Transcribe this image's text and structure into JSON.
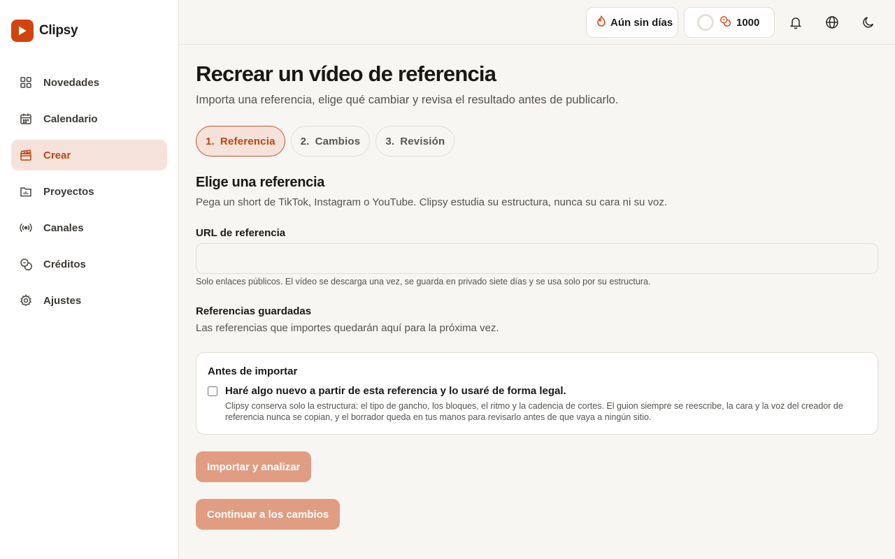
{
  "app": {
    "name": "Clipsy"
  },
  "sidebar": {
    "items": [
      {
        "label": "Novedades",
        "icon": "grid-icon"
      },
      {
        "label": "Calendario",
        "icon": "calendar-icon"
      },
      {
        "label": "Crear",
        "icon": "clapperboard-icon",
        "active": true
      },
      {
        "label": "Proyectos",
        "icon": "folder-chart-icon"
      },
      {
        "label": "Canales",
        "icon": "broadcast-icon"
      },
      {
        "label": "Créditos",
        "icon": "coins-icon"
      },
      {
        "label": "Ajustes",
        "icon": "gear-icon"
      }
    ]
  },
  "topbar": {
    "streak_label": "Aún sin días",
    "credits_value": "1000",
    "icons": [
      "flame-icon",
      "progress-ring-icon",
      "coins-icon",
      "bell-icon",
      "globe-icon",
      "moon-icon"
    ]
  },
  "main": {
    "title": "Recrear un vídeo de referencia",
    "subtitle": "Importa una referencia, elige qué cambiar y revisa el resultado antes de publicarlo.",
    "steps": [
      {
        "num": "1.",
        "label": "Referencia",
        "active": true
      },
      {
        "num": "2.",
        "label": "Cambios"
      },
      {
        "num": "3.",
        "label": "Revisión"
      }
    ],
    "section_title": "Elige una referencia",
    "section_desc": "Pega un short de TikTok, Instagram o YouTube. Clipsy estudia su estructura, nunca su cara ni su voz.",
    "url_label": "URL de referencia",
    "url_value": "",
    "url_hint": "Solo enlaces públicos. El vídeo se descarga una vez, se guarda en privado siete días y se usa solo por su estructura.",
    "saved_title": "Referencias guardadas",
    "saved_desc": "Las referencias que importes quedarán aquí para la próxima vez.",
    "legal": {
      "title": "Antes de importar",
      "checkbox_label": "Haré algo nuevo a partir de esta referencia y lo usaré de forma legal.",
      "checked": false,
      "text": "Clipsy conserva solo la estructura: el tipo de gancho, los bloques, el ritmo y la cadencia de cortes. El guion siempre se reescribe, la cara y la voz del creador de referencia nunca se copian, y el borrador queda en tus manos para revisarlo antes de que vaya a ningún sitio."
    },
    "import_button": "Importar y analizar",
    "continue_button": "Continuar a los cambios"
  },
  "colors": {
    "accent": "#d2440f",
    "active_bg": "#f5e3db",
    "button_disabled": "#e09d82",
    "background": "#f8f6f2"
  }
}
